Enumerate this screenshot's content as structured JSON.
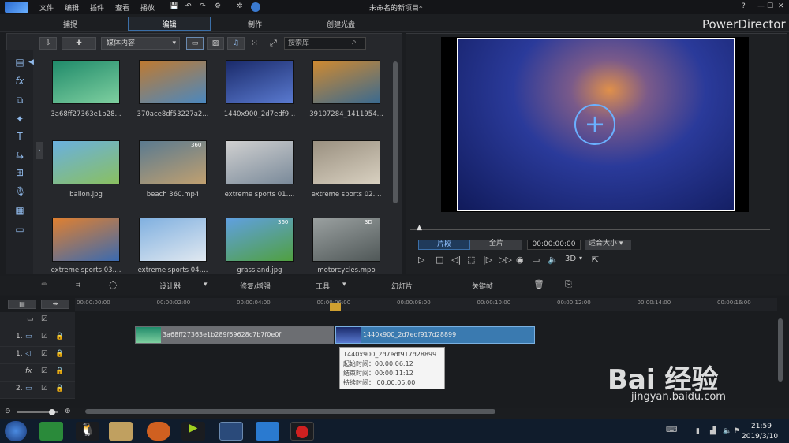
{
  "menu": {
    "file": "文件",
    "edit": "编辑",
    "plugins": "插件",
    "view": "查看",
    "play": "播放",
    "project_title": "未命名的新项目*",
    "help": "?"
  },
  "tabs": {
    "capture": "捕捉",
    "edit": "编辑",
    "produce": "制作",
    "disc": "创建光盘"
  },
  "brand": "PowerDirector",
  "library": {
    "dropdown": "媒体内容",
    "search_placeholder": "搜索库",
    "items": [
      {
        "label": "3a68ff27363e1b28...",
        "c1": "#1f8a6a",
        "c2": "#7fd0a0"
      },
      {
        "label": "370ace8df53227a2...",
        "c1": "#c07a30",
        "c2": "#4a88c0"
      },
      {
        "label": "1440x900_2d7edf9...",
        "c1": "#1a2a6a",
        "c2": "#5a7ad0"
      },
      {
        "label": "39107284_1411954...",
        "c1": "#d08a30",
        "c2": "#3a6a90"
      },
      {
        "label": "ballon.jpg",
        "c1": "#6ab0e0",
        "c2": "#8ac060"
      },
      {
        "label": "beach 360.mp4",
        "c1": "#5a7a90",
        "c2": "#c0a070",
        "badge": "360"
      },
      {
        "label": "extreme sports 01....",
        "c1": "#d0d0d0",
        "c2": "#7a8a9a"
      },
      {
        "label": "extreme sports 02....",
        "c1": "#9a9080",
        "c2": "#d8d0c0"
      },
      {
        "label": "extreme sports 03....",
        "c1": "#e08030",
        "c2": "#3a6ab0"
      },
      {
        "label": "extreme sports 04....",
        "c1": "#80b0e0",
        "c2": "#e0e8f0"
      },
      {
        "label": "grassland.jpg",
        "c1": "#60a0e0",
        "c2": "#50a040",
        "badge": "360"
      },
      {
        "label": "motorcycles.mpo",
        "c1": "#9aa0a0",
        "c2": "#505858",
        "badge": "3D"
      }
    ]
  },
  "preview": {
    "clip_btn": "片段",
    "full_btn": "全片",
    "timecode": "00:00:00:00",
    "fit": "适合大小",
    "mode3d": "3D"
  },
  "toolbar": {
    "designer": "设计器",
    "fix": "修复/增强",
    "tools": "工具",
    "slideshow": "幻灯片",
    "keyframe": "关键帧"
  },
  "ruler": [
    "00:00:00:00",
    "00:00:02:00",
    "00:00:04:00",
    "00:00:06:00",
    "00:00:08:00",
    "00:00:10:00",
    "00:00:12:00",
    "00:00:14:00",
    "00:00:16:00"
  ],
  "tracks": [
    "1.",
    "1.",
    "fx",
    "2."
  ],
  "clips": {
    "a": "3a68ff27363e1b289f69628c7b7f0e0f",
    "b": "1440x900_2d7edf917d28899"
  },
  "tooltip": {
    "name": "1440x900_2d7edf917d28899",
    "start": "起始时间：00:00:06:12",
    "end": "结束时间：00:00:11:12",
    "dur": "持续时间： 00:00:05:00"
  },
  "watermark": {
    "logo": "Bai 经验",
    "url": "jingyan.baidu.com"
  },
  "clock": {
    "time": "21:59",
    "date": "2019/3/10"
  }
}
